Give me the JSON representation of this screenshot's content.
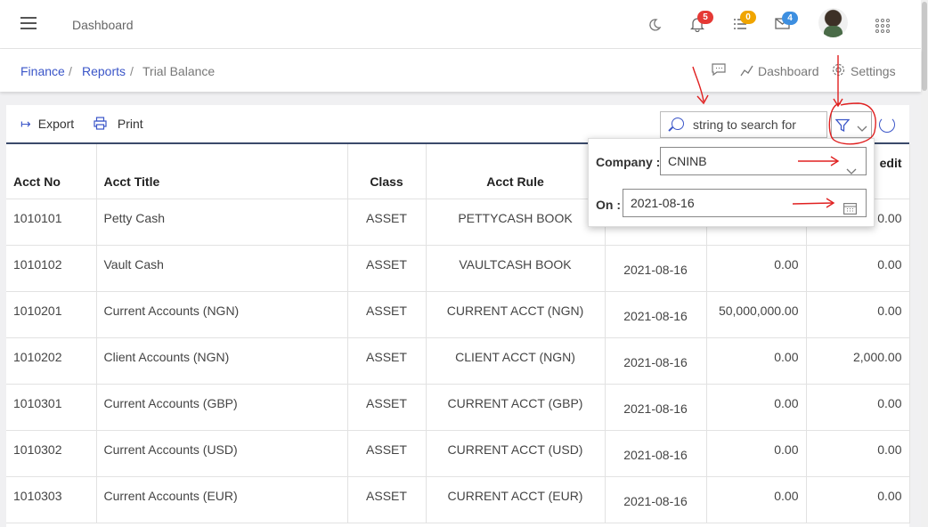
{
  "topbar": {
    "title": "Dashboard",
    "notifications_count": "5",
    "tasks_count": "0",
    "messages_count": "4",
    "colors": {
      "red_badge": "#e53935",
      "orange_badge": "#f0a500",
      "blue_badge": "#3d8fe0"
    }
  },
  "breadcrumb": {
    "items": [
      "Finance",
      "Reports",
      "Trial Balance"
    ],
    "separator": "/"
  },
  "right_links": {
    "dashboard": "Dashboard",
    "settings": "Settings"
  },
  "toolbar": {
    "export": "Export",
    "print": "Print",
    "search_placeholder": "string to search for"
  },
  "table": {
    "headers": {
      "acct_no": "Acct No",
      "acct_title": "Acct Title",
      "class": "Class",
      "acct_rule": "Acct Rule",
      "credit_partial": "edit"
    },
    "rows": [
      {
        "acct_no": "1010101",
        "title": "Petty Cash",
        "class": "ASSET",
        "rule": "PETTYCASH BOOK",
        "date": "",
        "debit": "",
        "credit": "0.00"
      },
      {
        "acct_no": "1010102",
        "title": "Vault Cash",
        "class": "ASSET",
        "rule": "VAULTCASH BOOK",
        "date": "2021-08-16",
        "debit": "0.00",
        "credit": "0.00"
      },
      {
        "acct_no": "1010201",
        "title": "Current Accounts (NGN)",
        "class": "ASSET",
        "rule": "CURRENT ACCT (NGN)",
        "date": "2021-08-16",
        "debit": "50,000,000.00",
        "credit": "0.00"
      },
      {
        "acct_no": "1010202",
        "title": "Client Accounts (NGN)",
        "class": "ASSET",
        "rule": "CLIENT ACCT (NGN)",
        "date": "2021-08-16",
        "debit": "0.00",
        "credit": "2,000.00"
      },
      {
        "acct_no": "1010301",
        "title": "Current Accounts (GBP)",
        "class": "ASSET",
        "rule": "CURRENT ACCT (GBP)",
        "date": "2021-08-16",
        "debit": "0.00",
        "credit": "0.00"
      },
      {
        "acct_no": "1010302",
        "title": "Current Accounts (USD)",
        "class": "ASSET",
        "rule": "CURRENT ACCT (USD)",
        "date": "2021-08-16",
        "debit": "0.00",
        "credit": "0.00"
      },
      {
        "acct_no": "1010303",
        "title": "Current Accounts (EUR)",
        "class": "ASSET",
        "rule": "CURRENT ACCT (EUR)",
        "date": "2021-08-16",
        "debit": "0.00",
        "credit": "0.00"
      }
    ]
  },
  "filter_popup": {
    "company_label": "Company :",
    "company_value": "CNINB",
    "on_label": "On :",
    "on_value": "2021-08-16"
  }
}
